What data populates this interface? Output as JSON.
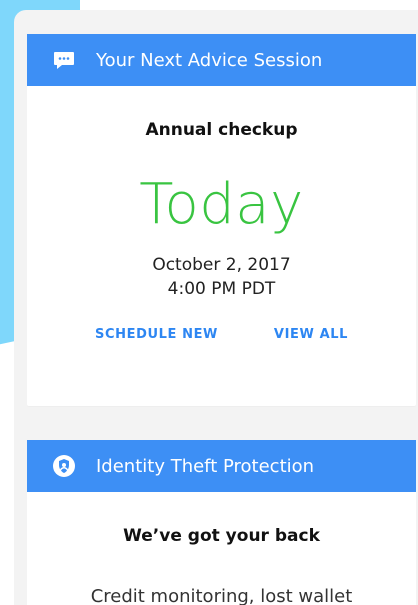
{
  "advice_card": {
    "title": "Your Next Advice Session",
    "session_name": "Annual checkup",
    "day_label": "Today",
    "date": "October 2, 2017",
    "time": "4:00 PM PDT",
    "schedule_new_label": "SCHEDULE NEW",
    "view_all_label": "VIEW ALL",
    "header_icon": "chat-bubble-icon"
  },
  "identity_card": {
    "title": "Identity Theft Protection",
    "subtitle": "We’ve got your back",
    "description": "Credit monitoring, lost wallet",
    "header_icon": "shield-icon"
  },
  "colors": {
    "header_blue": "#3d8ff5",
    "today_green": "#39c441",
    "link_blue": "#2d86f2",
    "background_panel": "#f3f3f3",
    "accent_cyan": "#7fd7fb"
  }
}
